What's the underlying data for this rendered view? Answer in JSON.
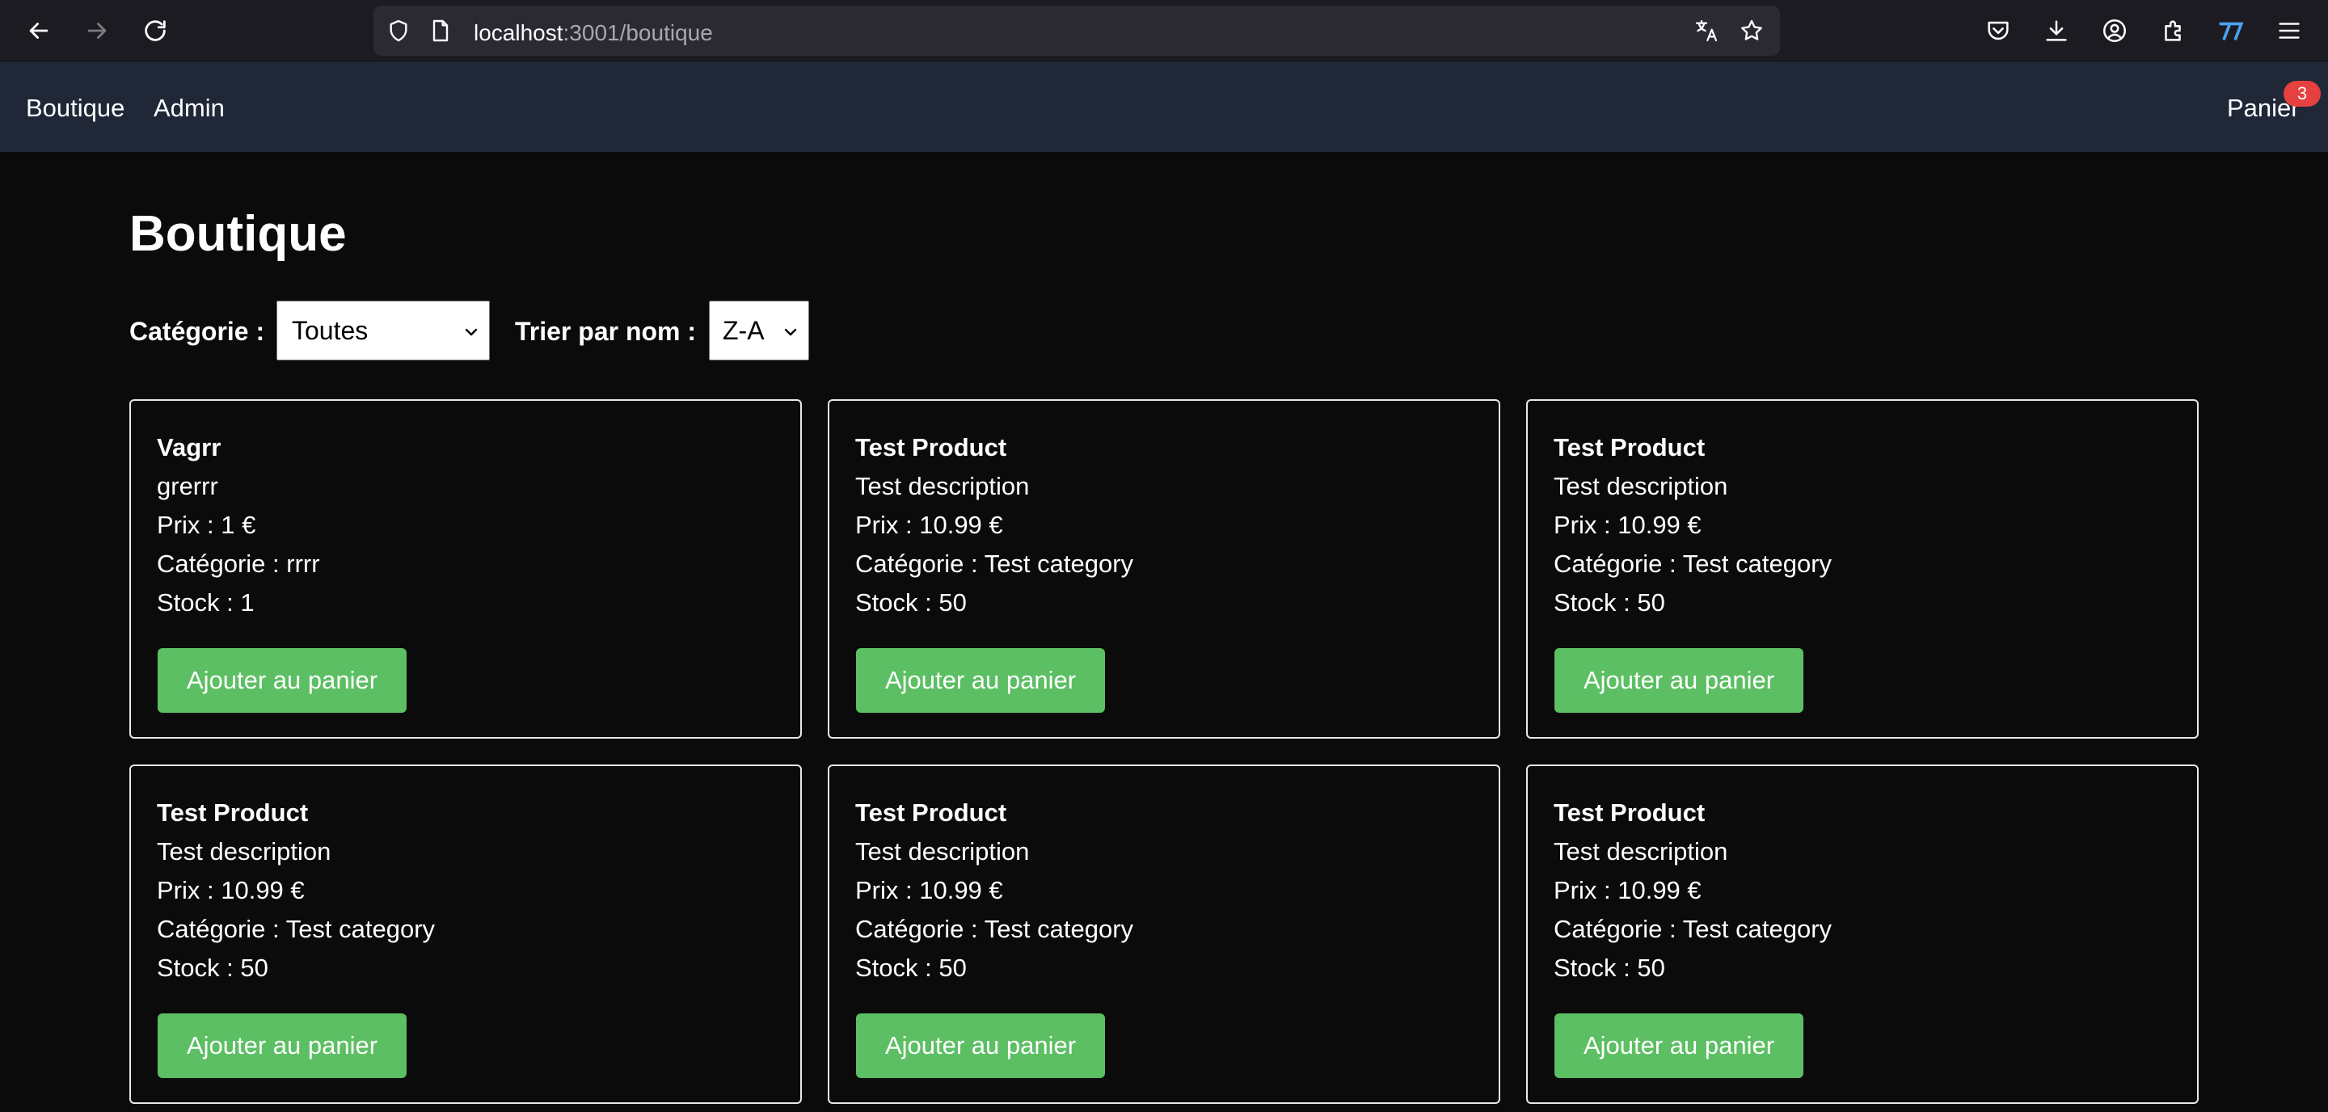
{
  "browser": {
    "url_host": "localhost",
    "url_path": ":3001/boutique"
  },
  "nav": {
    "links": [
      "Boutique",
      "Admin"
    ],
    "cart_label": "Panier",
    "cart_count": "3"
  },
  "page": {
    "title": "Boutique",
    "category_label": "Catégorie :",
    "category_value": "Toutes",
    "sort_label": "Trier par nom :",
    "sort_value": "Z-A"
  },
  "products": [
    {
      "name": "Vagrr",
      "description": "grerrr",
      "price": "Prix : 1 €",
      "category": "Catégorie : rrrr",
      "stock": "Stock : 1",
      "button": "Ajouter au panier"
    },
    {
      "name": "Test Product",
      "description": "Test description",
      "price": "Prix : 10.99 €",
      "category": "Catégorie : Test category",
      "stock": "Stock : 50",
      "button": "Ajouter au panier"
    },
    {
      "name": "Test Product",
      "description": "Test description",
      "price": "Prix : 10.99 €",
      "category": "Catégorie : Test category",
      "stock": "Stock : 50",
      "button": "Ajouter au panier"
    },
    {
      "name": "Test Product",
      "description": "Test description",
      "price": "Prix : 10.99 €",
      "category": "Catégorie : Test category",
      "stock": "Stock : 50",
      "button": "Ajouter au panier"
    },
    {
      "name": "Test Product",
      "description": "Test description",
      "price": "Prix : 10.99 €",
      "category": "Catégorie : Test category",
      "stock": "Stock : 50",
      "button": "Ajouter au panier"
    },
    {
      "name": "Test Product",
      "description": "Test description",
      "price": "Prix : 10.99 €",
      "category": "Catégorie : Test category",
      "stock": "Stock : 50",
      "button": "Ajouter au panier"
    }
  ],
  "colors": {
    "button_green": "#5cbf63",
    "navbar": "#202838",
    "badge_red": "#e5413f"
  }
}
